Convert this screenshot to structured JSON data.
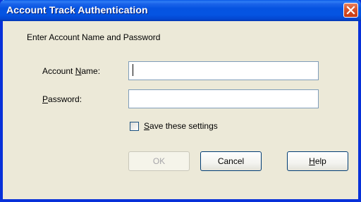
{
  "window": {
    "title": "Account Track Authentication"
  },
  "form": {
    "instruction": "Enter Account Name and Password",
    "account_label_prefix": "Account ",
    "account_label_accel": "N",
    "account_label_suffix": "ame:",
    "account_value": "",
    "password_label_accel": "P",
    "password_label_suffix": "assword:",
    "password_value": "",
    "save_label_accel": "S",
    "save_label_suffix": "ave these settings",
    "save_checked": false
  },
  "buttons": {
    "ok": "OK",
    "cancel": "Cancel",
    "help_accel": "H",
    "help_suffix": "elp"
  },
  "colors": {
    "titlebar": "#0553e1",
    "dialog_bg": "#ece9d8",
    "close_button": "#d8552c",
    "disabled_text": "#a7a6aa"
  },
  "icons": {
    "close": "close-icon"
  }
}
